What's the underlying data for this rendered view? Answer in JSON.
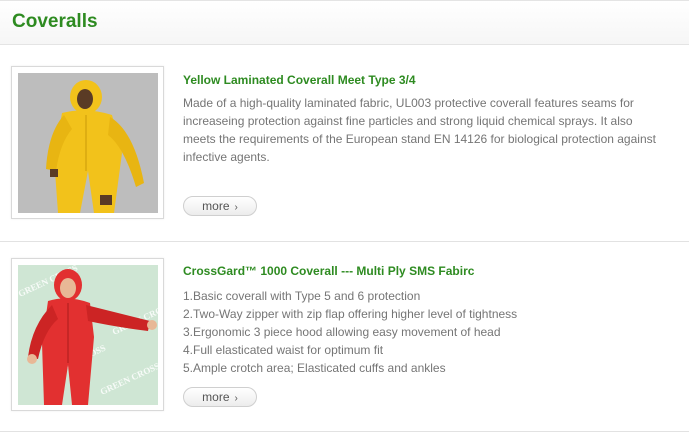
{
  "header": {
    "title": "Coveralls"
  },
  "products": [
    {
      "name": "Yellow Laminated Coverall Meet Type 3/4",
      "description": "Made of a high-quality laminated fabric, UL003 protective coverall features seams for increaseing protection against fine particles and strong liquid chemical sprays. It also meets the requirements of the European stand EN 14126 for biological protection against infective agents.",
      "more_label": "more",
      "more_icon": "chevron-right-icon",
      "image_color": "#f2c21b"
    },
    {
      "name": "CrossGard™ 1000 Coverall --- Multi Ply SMS Fabirc",
      "features": [
        "1.Basic coverall with Type 5 and 6 protection",
        "2.Two-Way zipper with zip flap offering higher level of tightness",
        "3.Ergonomic 3 piece hood allowing easy movement of head",
        "4.Full elasticated waist for optimum fit",
        "5.Ample crotch area; Elasticated cuffs and ankles"
      ],
      "more_label": "more",
      "more_icon": "chevron-right-icon",
      "image_color": "#e23030",
      "watermark": "GREEN CROSS"
    }
  ],
  "colors": {
    "accent": "#2e8b21",
    "text": "#757575"
  }
}
